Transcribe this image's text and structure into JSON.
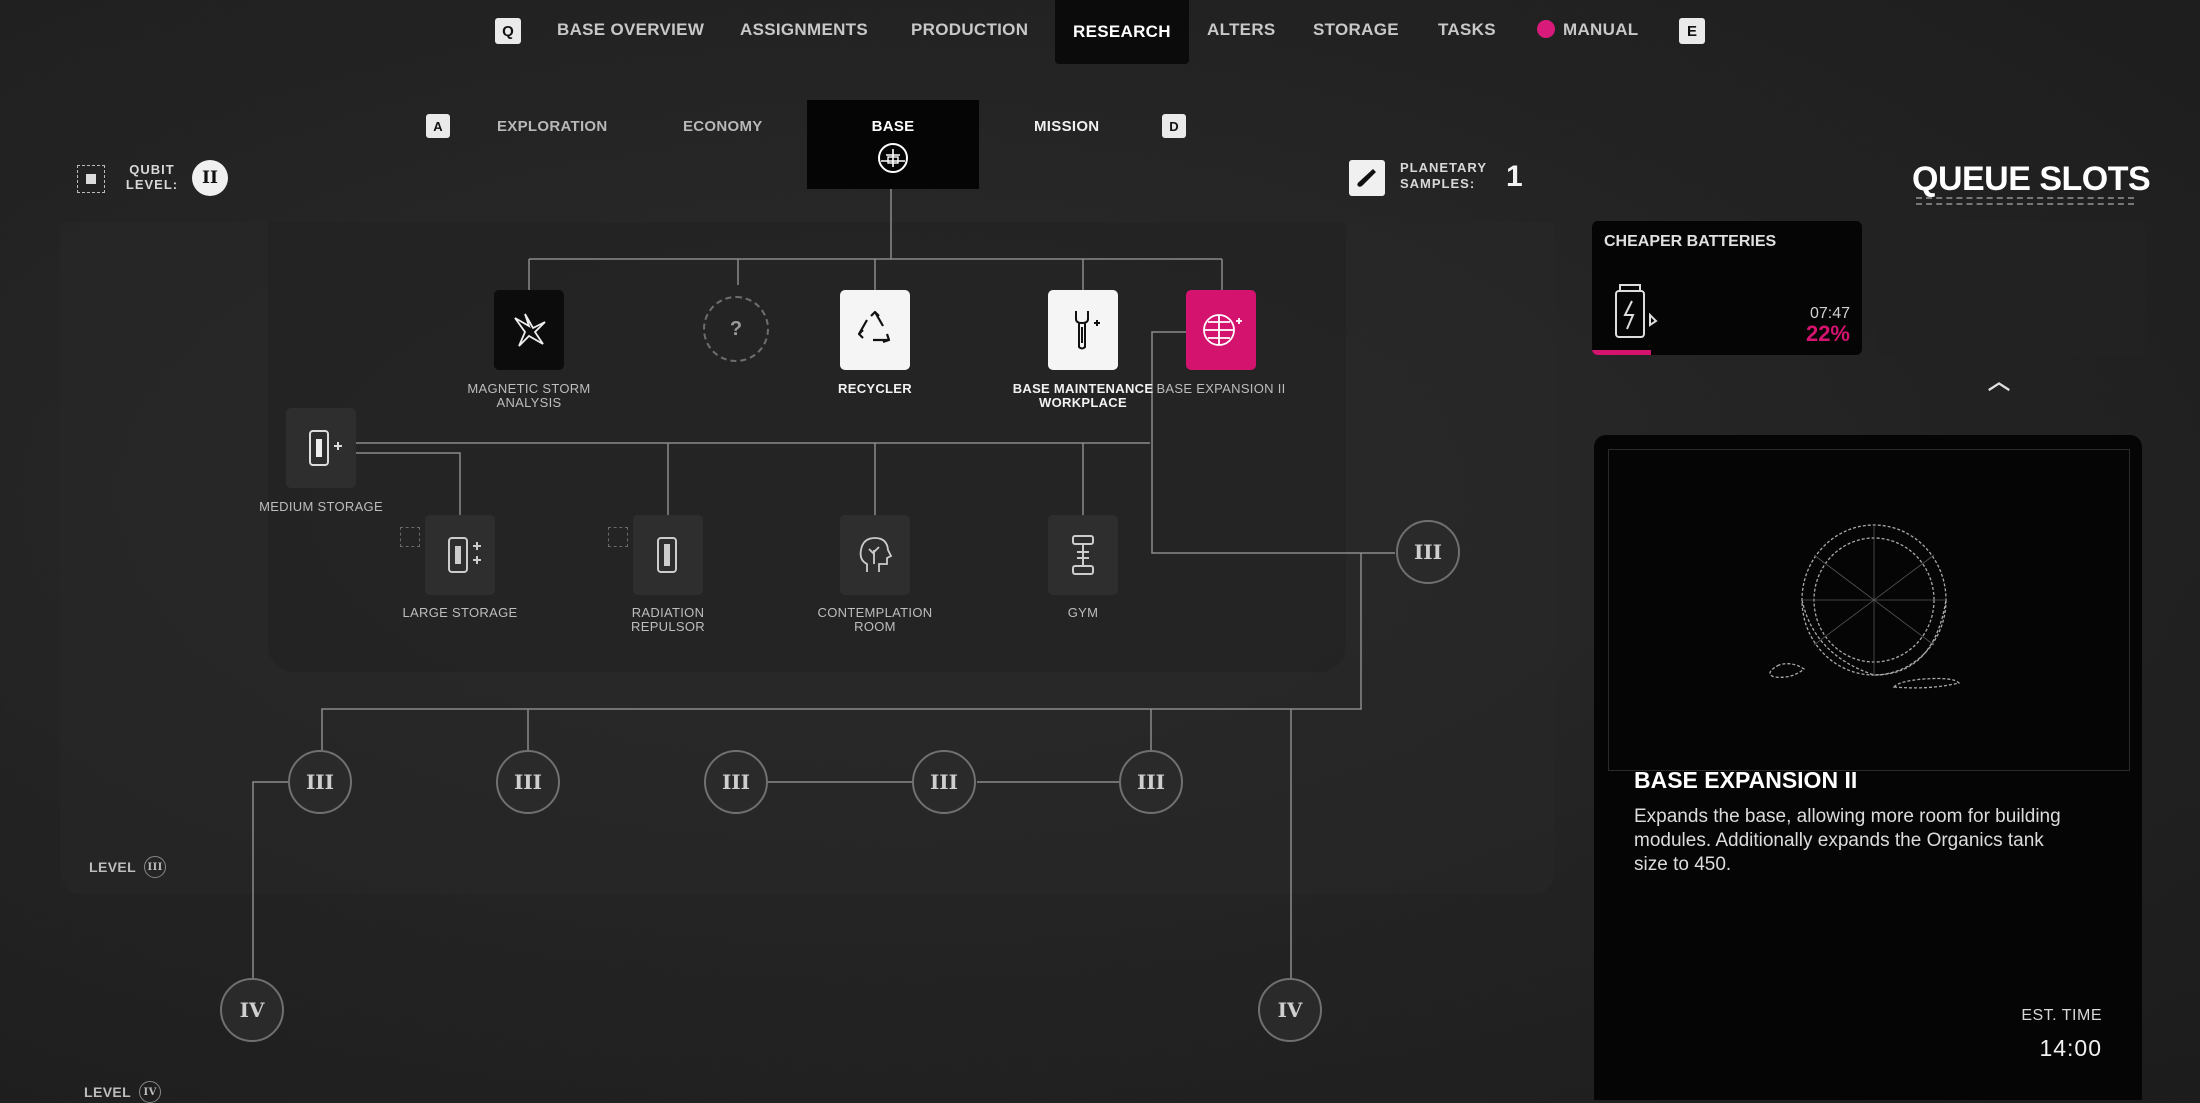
{
  "nav": {
    "left_key": "Q",
    "right_key": "E",
    "items": [
      "BASE OVERVIEW",
      "ASSIGNMENTS",
      "PRODUCTION",
      "RESEARCH",
      "ALTERS",
      "STORAGE",
      "TASKS",
      "MANUAL"
    ],
    "active": "RESEARCH"
  },
  "subtabs": {
    "left_key": "A",
    "right_key": "D",
    "items": [
      "EXPLORATION",
      "ECONOMY",
      "BASE",
      "MISSION"
    ],
    "active": "BASE"
  },
  "qubit": {
    "label": "QUBIT LEVEL:",
    "value": "II"
  },
  "samples": {
    "label": "PLANETARY SAMPLES:",
    "value": "1"
  },
  "tree": {
    "top_nodes": [
      {
        "label": "MAGNETIC STORM ANALYSIS",
        "icon": "magnetic-storm-icon",
        "state": "dark"
      },
      {
        "label": "?",
        "icon": "unknown-icon",
        "state": "locked"
      },
      {
        "label": "RECYCLER",
        "icon": "recycle-icon",
        "state": "white"
      },
      {
        "label": "BASE MAINTENANCE WORKPLACE",
        "icon": "wrench-icon",
        "state": "white"
      },
      {
        "label": "BASE EXPANSION II",
        "icon": "globe-plus-icon",
        "state": "selected"
      }
    ],
    "medium_storage": {
      "label": "MEDIUM STORAGE",
      "icon": "battery-plus-icon"
    },
    "bottom_nodes": [
      {
        "label": "LARGE STORAGE",
        "icon": "battery-plus-icon"
      },
      {
        "label": "RADIATION REPULSOR",
        "icon": "battery-icon"
      },
      {
        "label": "CONTEMPLATION ROOM",
        "icon": "head-tree-icon"
      },
      {
        "label": "GYM",
        "icon": "dumbbell-icon"
      }
    ],
    "tier3_circles": [
      "III",
      "III",
      "III",
      "III",
      "III",
      "III"
    ],
    "tier4_circles": [
      "IV",
      "IV"
    ],
    "level3_label": "LEVEL",
    "level3_value": "III",
    "level4_label": "LEVEL",
    "level4_value": "IV"
  },
  "queue": {
    "title": "QUEUE SLOTS",
    "slot1": {
      "title": "CHEAPER BATTERIES",
      "time": "07:47",
      "percent": "22%",
      "progress": 0.22,
      "icon": "battery-icon"
    },
    "collapse_icon": "chevron-up-icon"
  },
  "info": {
    "title": "BASE EXPANSION II",
    "description": "Expands the base, allowing more room for building modules. Additionally expands the Organics tank size to 450.",
    "est_label": "EST. TIME",
    "est_value": "14:00",
    "icon": "ring-blueprint-icon"
  },
  "colors": {
    "accent": "#d4136f",
    "background": "#252525",
    "card": "#050505"
  }
}
